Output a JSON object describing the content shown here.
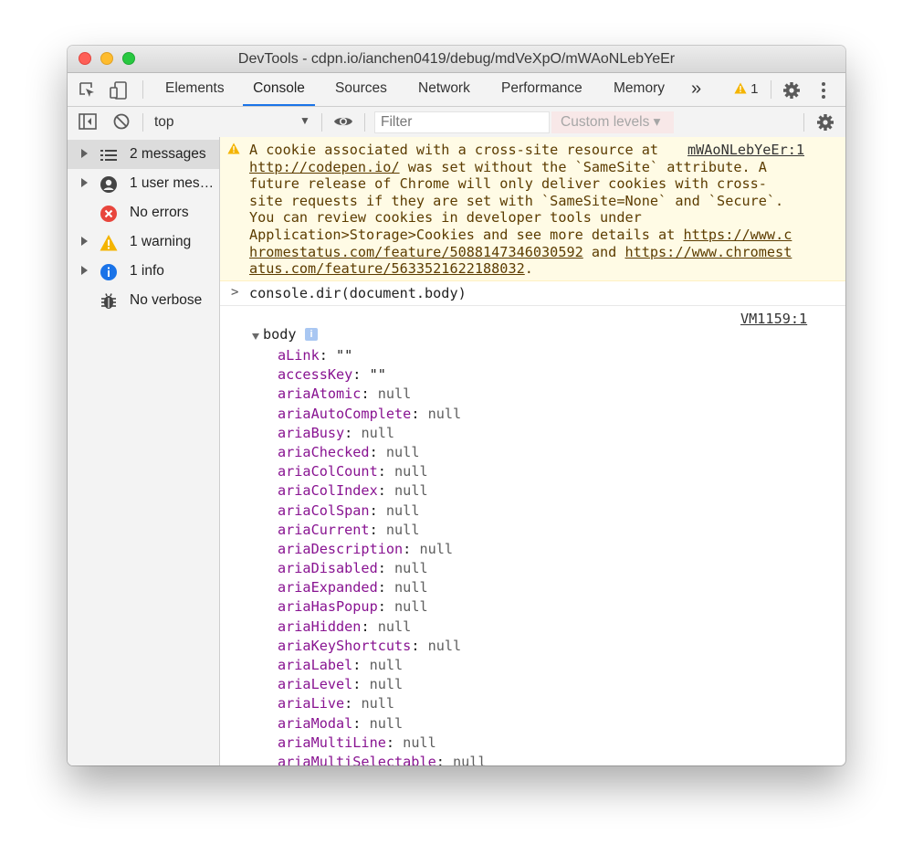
{
  "window": {
    "title": "DevTools - cdpn.io/ianchen0419/debug/mdVeXpO/mWAoNLebYeEr"
  },
  "tabs": [
    {
      "label": "Elements"
    },
    {
      "label": "Console"
    },
    {
      "label": "Sources"
    },
    {
      "label": "Network"
    },
    {
      "label": "Performance"
    },
    {
      "label": "Memory"
    }
  ],
  "active_tab": "Console",
  "more_tabs": "»",
  "warning_count": "1",
  "console_toolbar": {
    "context": "top",
    "filter_placeholder": "Filter",
    "levels_label": "Custom levels ▾"
  },
  "sidebar": {
    "items": [
      {
        "label": "2 messages",
        "icon": "list-icon",
        "expandable": true,
        "selected": true
      },
      {
        "label": "1 user mes…",
        "icon": "user-icon",
        "expandable": true
      },
      {
        "label": "No errors",
        "icon": "error-icon",
        "expandable": false
      },
      {
        "label": "1 warning",
        "icon": "warning-icon",
        "expandable": true
      },
      {
        "label": "1 info",
        "icon": "info-icon",
        "expandable": true
      },
      {
        "label": "No verbose",
        "icon": "bug-icon",
        "expandable": false
      }
    ]
  },
  "warning_message": {
    "source": "mWAoNLebYeEr:1",
    "line1": "A cookie associated with a cross-site resource at ",
    "line2_link": "http://codepen.io/",
    "line2_rest": " was set without the `SameSite` attribute. A",
    "line3": "future release of Chrome will only deliver cookies with cross-",
    "line4": "site requests if they are set with `SameSite=None` and `Secure`.",
    "line5": "You can review cookies in developer tools under",
    "line6_text": "Application>Storage>Cookies and see more details at ",
    "line6_link": "https://www.c",
    "line7_link_a": "hromestatus.com/feature/5088147346030592",
    "line7_mid": " and ",
    "line7_link_b": "https://www.chromest",
    "line8_link": "atus.com/feature/5633521622188032",
    "line8_end": "."
  },
  "command": {
    "prompt": ">",
    "text": "console.dir(document.body)"
  },
  "result": {
    "source": "VM1159:1",
    "object_name": "body",
    "info_badge": "i",
    "properties": [
      {
        "key": "aLink",
        "value": "\"\""
      },
      {
        "key": "accessKey",
        "value": "\"\""
      },
      {
        "key": "ariaAtomic",
        "value": "null"
      },
      {
        "key": "ariaAutoComplete",
        "value": "null"
      },
      {
        "key": "ariaBusy",
        "value": "null"
      },
      {
        "key": "ariaChecked",
        "value": "null"
      },
      {
        "key": "ariaColCount",
        "value": "null"
      },
      {
        "key": "ariaColIndex",
        "value": "null"
      },
      {
        "key": "ariaColSpan",
        "value": "null"
      },
      {
        "key": "ariaCurrent",
        "value": "null"
      },
      {
        "key": "ariaDescription",
        "value": "null"
      },
      {
        "key": "ariaDisabled",
        "value": "null"
      },
      {
        "key": "ariaExpanded",
        "value": "null"
      },
      {
        "key": "ariaHasPopup",
        "value": "null"
      },
      {
        "key": "ariaHidden",
        "value": "null"
      },
      {
        "key": "ariaKeyShortcuts",
        "value": "null"
      },
      {
        "key": "ariaLabel",
        "value": "null"
      },
      {
        "key": "ariaLevel",
        "value": "null"
      },
      {
        "key": "ariaLive",
        "value": "null"
      },
      {
        "key": "ariaModal",
        "value": "null"
      },
      {
        "key": "ariaMultiLine",
        "value": "null"
      },
      {
        "key": "ariaMultiSelectable",
        "value": "null"
      }
    ]
  },
  "colors": {
    "accent": "#1a73e8",
    "warning_bg": "#fffbe5",
    "warning_text": "#5c3c00",
    "property_key": "#881391"
  }
}
